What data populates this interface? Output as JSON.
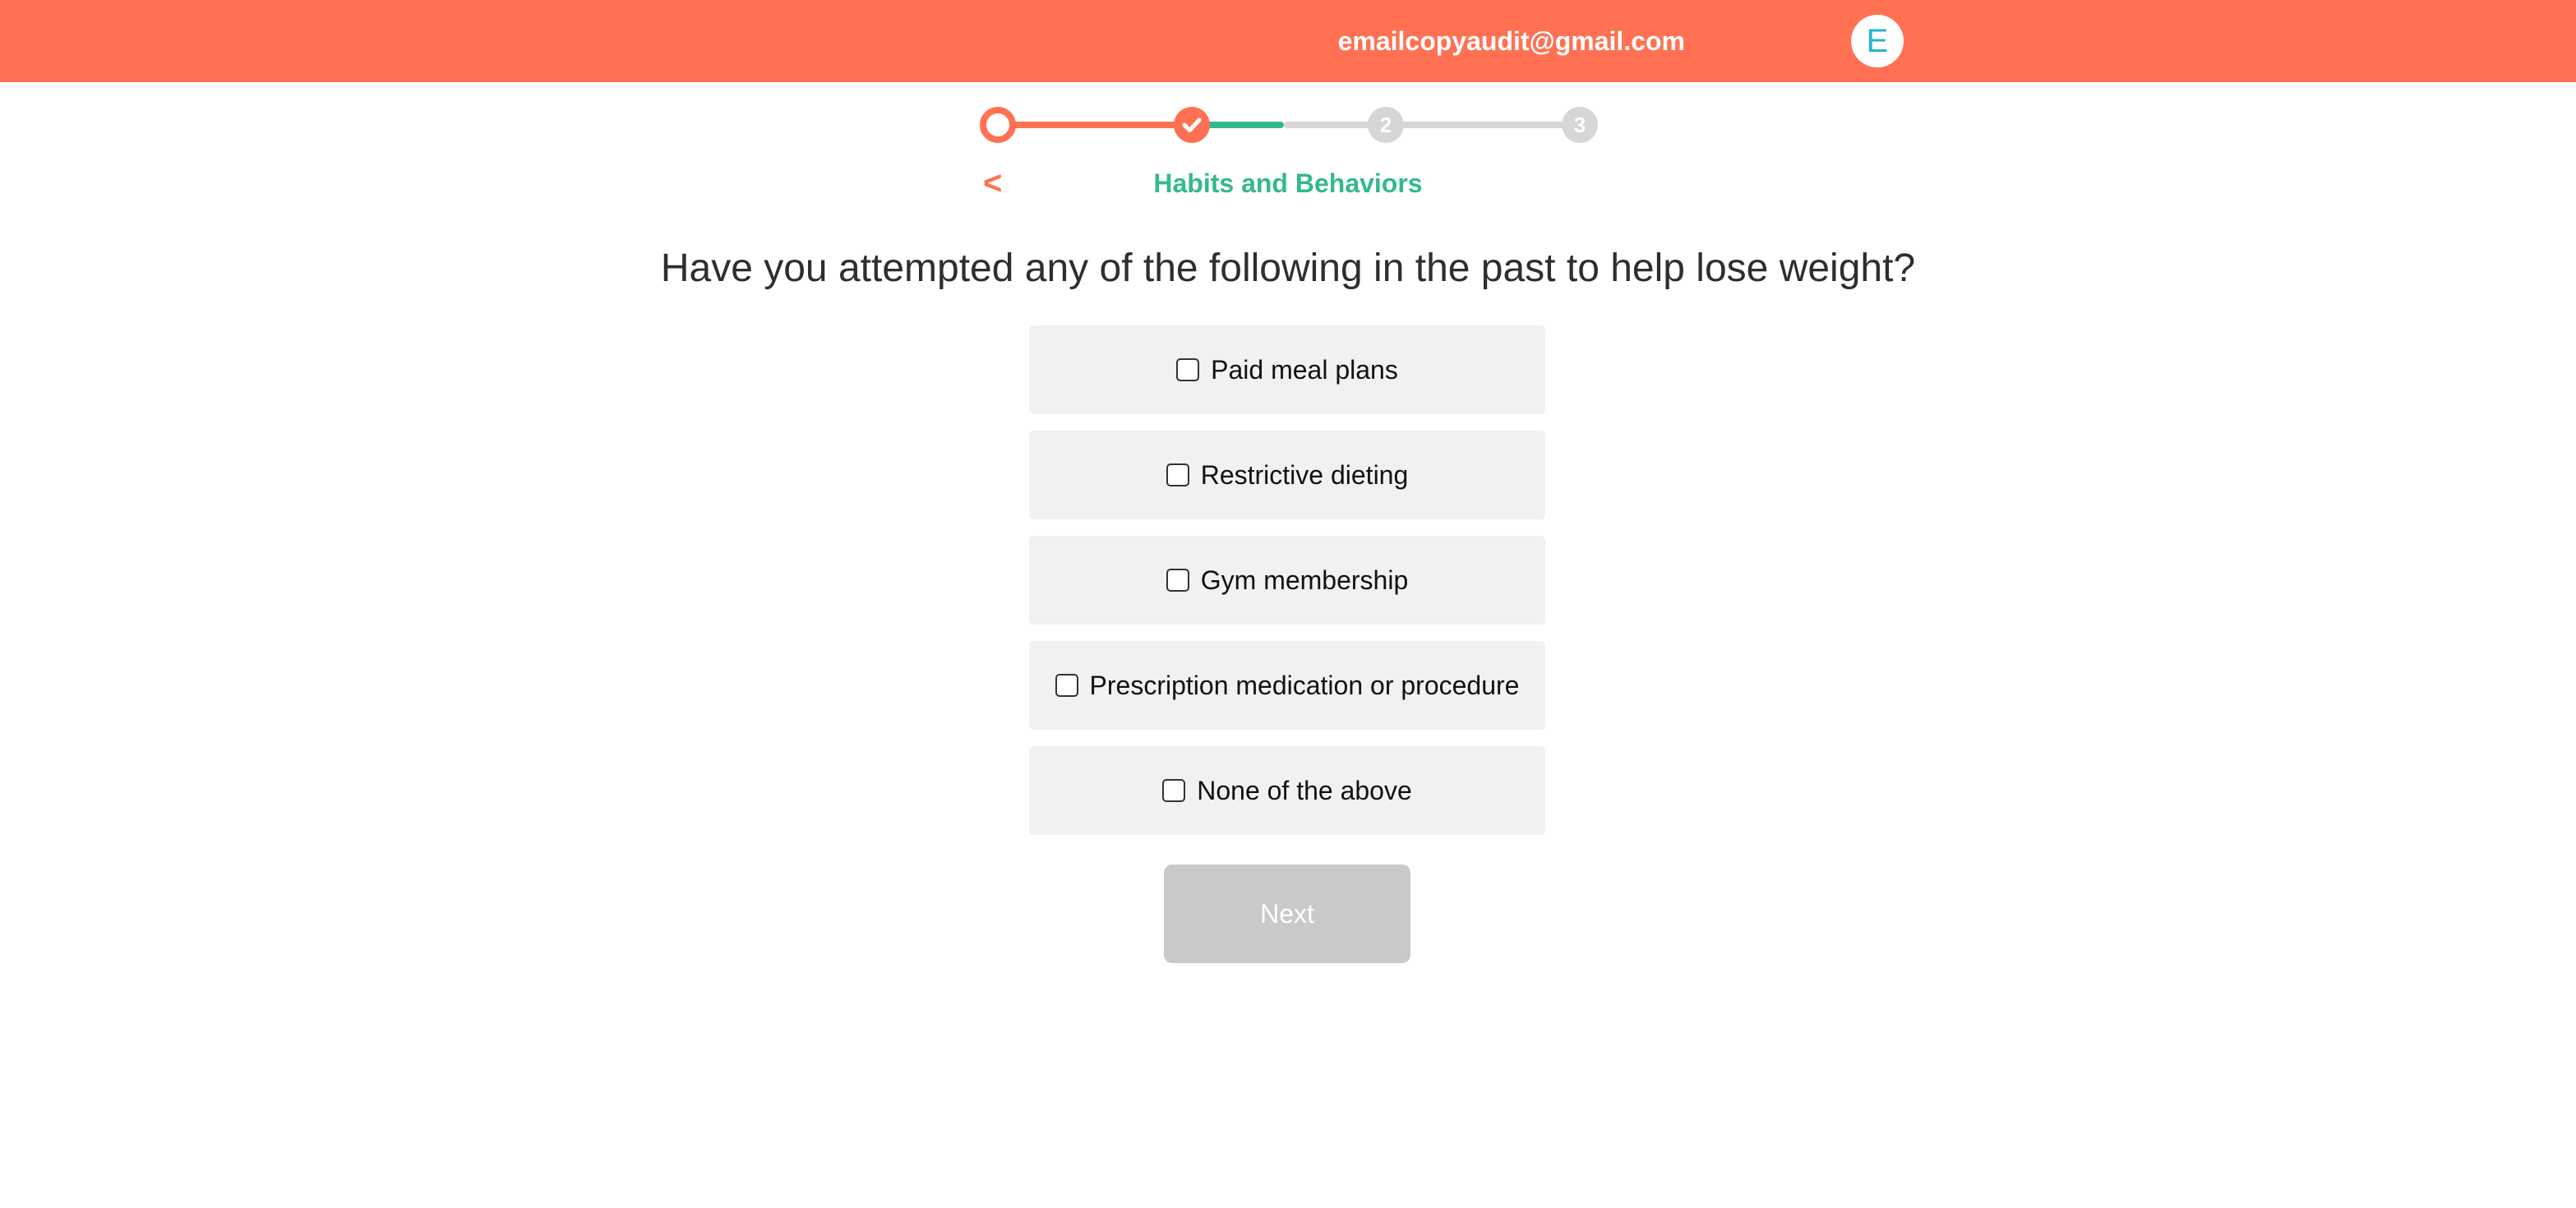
{
  "header": {
    "user_email": "emailcopyaudit@gmail.com",
    "avatar_letter": "E",
    "bar_color": "#ff7152"
  },
  "progress": {
    "steps": [
      {
        "label": "",
        "state": "current"
      },
      {
        "label": "",
        "state": "completed",
        "icon": "check-icon"
      },
      {
        "label": "2",
        "state": "pending"
      },
      {
        "label": "3",
        "state": "pending"
      }
    ],
    "colors": {
      "active": "#ff7152",
      "partial": "#33b98e",
      "pending": "#d6d6d6"
    }
  },
  "nav": {
    "back_label": "<",
    "section_title": "Habits and Behaviors"
  },
  "question": "Have you attempted any of the following in the past to help lose weight?",
  "options": [
    {
      "label": "Paid meal plans",
      "checked": false
    },
    {
      "label": "Restrictive dieting",
      "checked": false
    },
    {
      "label": "Gym membership",
      "checked": false
    },
    {
      "label": "Prescription medication or procedure",
      "checked": false
    },
    {
      "label": "None of the above",
      "checked": false
    }
  ],
  "next_button": {
    "label": "Next",
    "enabled": false
  }
}
